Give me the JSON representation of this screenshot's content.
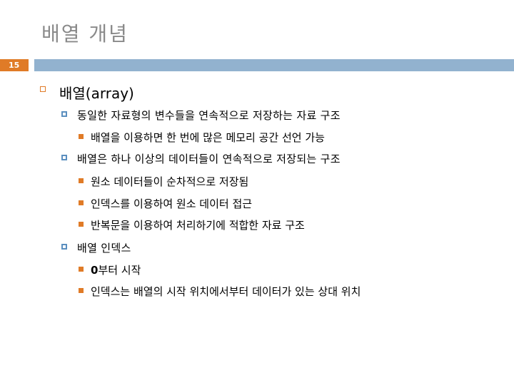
{
  "slide": {
    "title": "배열 개념",
    "page_number": "15"
  },
  "outline": {
    "level1": {
      "label": "배열(array)"
    },
    "items": [
      {
        "level": 2,
        "text": "동일한 자료형의 변수들을 연속적으로 저장하는 자료 구조"
      },
      {
        "level": 3,
        "text": "배열을 이용하면 한 번에 많은 메모리 공간 선언 가능"
      },
      {
        "level": 2,
        "text": "배열은 하나 이상의 데이터들이 연속적으로 저장되는 구조"
      },
      {
        "level": 3,
        "text": "원소 데이터들이 순차적으로 저장됨"
      },
      {
        "level": 3,
        "text": "인덱스를 이용하여 원소 데이터 접근"
      },
      {
        "level": 3,
        "text": "반복문을 이용하여 처리하기에 적합한 자료 구조"
      },
      {
        "level": 2,
        "text": "배열 인덱스"
      },
      {
        "level": 3,
        "text_bold": "0",
        "text": "부터 시작"
      },
      {
        "level": 3,
        "text": "인덱스는 배열의 시작 위치에서부터 데이터가 있는 상대 위치"
      }
    ]
  },
  "colors": {
    "accent_orange": "#e07b27",
    "header_bar_blue": "#92b2cf",
    "bullet_blue": "#5b8fbf",
    "title_gray": "#8a8a8a"
  }
}
